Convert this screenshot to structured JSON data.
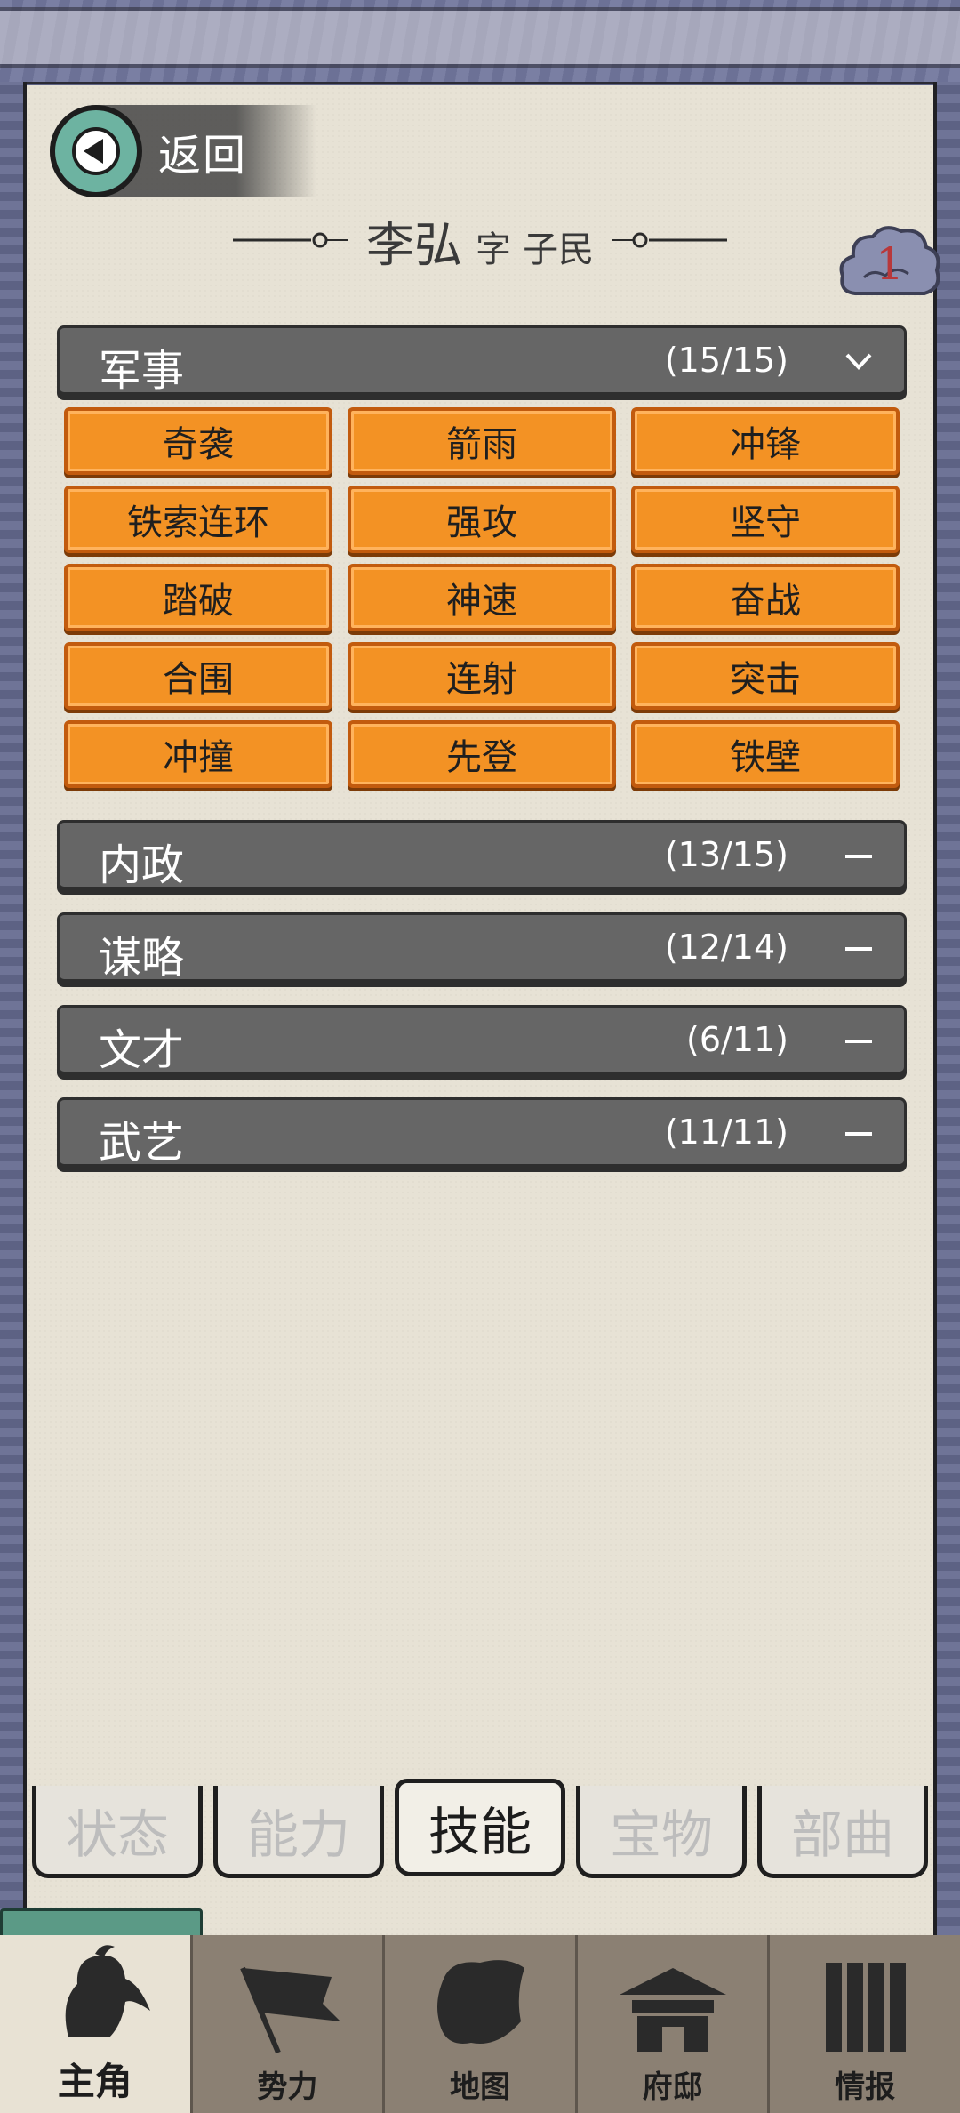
{
  "header": {
    "back_label": "返回",
    "name": "李弘",
    "zi_label": "字",
    "zi_value": "子民",
    "badge_count": "1"
  },
  "sections": [
    {
      "label": "军事",
      "count": "(15/15)",
      "expanded": true,
      "skills": [
        "奇袭",
        "箭雨",
        "冲锋",
        "铁索连环",
        "强攻",
        "坚守",
        "踏破",
        "神速",
        "奋战",
        "合围",
        "连射",
        "突击",
        "冲撞",
        "先登",
        "铁壁"
      ]
    },
    {
      "label": "内政",
      "count": "(13/15)",
      "expanded": false
    },
    {
      "label": "谋略",
      "count": "(12/14)",
      "expanded": false
    },
    {
      "label": "文才",
      "count": "(6/11)",
      "expanded": false
    },
    {
      "label": "武艺",
      "count": "(11/11)",
      "expanded": false
    }
  ],
  "tabs": [
    "状态",
    "能力",
    "技能",
    "宝物",
    "部曲"
  ],
  "active_tab": "技能",
  "bottom_nav": [
    "主角",
    "势力",
    "地图",
    "府邸",
    "情报"
  ],
  "active_nav": "主角",
  "colors": {
    "skill_orange": "#f39224",
    "section_gray": "#666666",
    "paper": "#e7e2d5",
    "badge_red": "#b8383b"
  }
}
